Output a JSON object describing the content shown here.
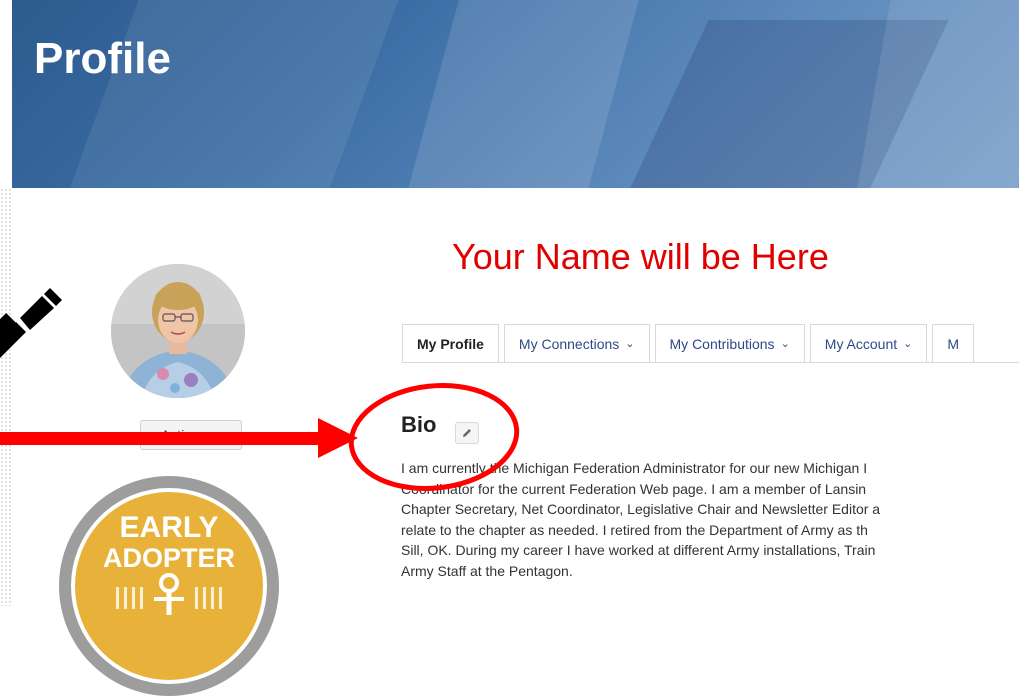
{
  "header": {
    "title": "Profile"
  },
  "profile": {
    "name_placeholder": "Your Name will be Here",
    "actions_label": "Actions"
  },
  "badge": {
    "line1": "EARLY",
    "line2": "ADOPTER"
  },
  "tabs": [
    {
      "label": "My Profile",
      "dropdown": false,
      "active": true
    },
    {
      "label": "My Connections",
      "dropdown": true
    },
    {
      "label": "My Contributions",
      "dropdown": true
    },
    {
      "label": "My Account",
      "dropdown": true
    },
    {
      "label": "M",
      "dropdown": false
    }
  ],
  "bio": {
    "heading": "Bio",
    "lines": [
      "I am currently the Michigan Federation Administrator for our new Michigan I",
      "Coordinator for the current Federation Web page.  I am a member of Lansin",
      "Chapter Secretary, Net Coordinator, Legislative Chair and Newsletter Editor a",
      "relate to the chapter as needed.  I retired from the Department of Army as th",
      "Sill, OK. During my career I have worked at different Army installations, Train",
      "Army Staff at the Pentagon."
    ]
  },
  "colors": {
    "annotation_red": "#ff0000",
    "name_red": "#e00000",
    "tab_link": "#2d4a86",
    "hero_blue": "#3d6fa6"
  },
  "icons": {
    "edit": "pencil-icon",
    "annotation_pen": "pen-icon",
    "dropdown": "chevron-down-icon"
  }
}
